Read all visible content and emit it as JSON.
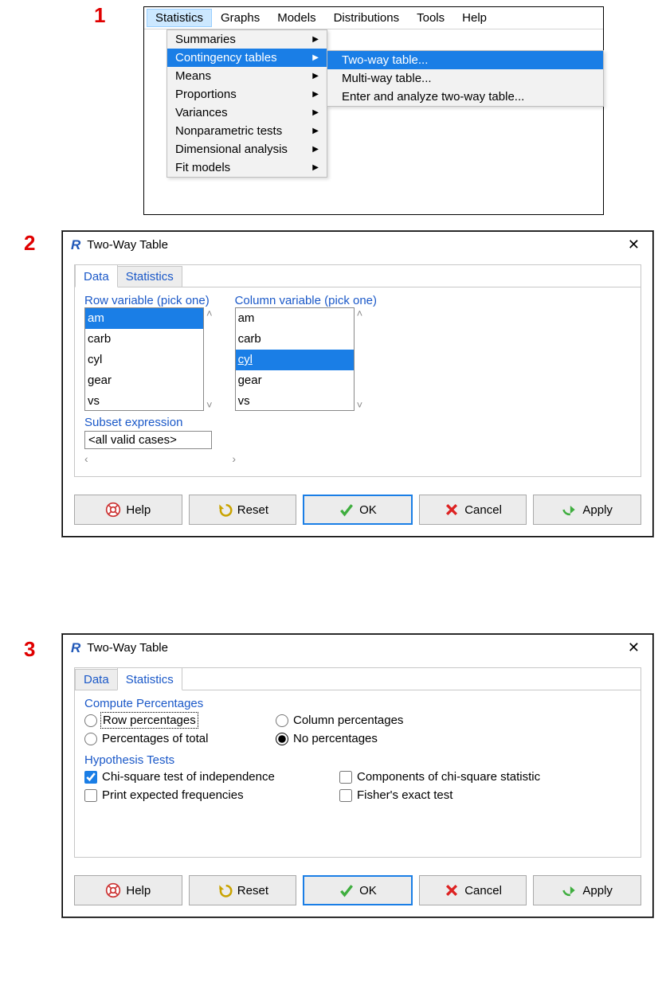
{
  "steps": {
    "s1": "1",
    "s2": "2",
    "s3": "3"
  },
  "menubar": {
    "items": [
      "Statistics",
      "Graphs",
      "Models",
      "Distributions",
      "Tools",
      "Help"
    ],
    "active": "Statistics"
  },
  "stats_menu": {
    "items": [
      {
        "label": "Summaries",
        "arrow": true
      },
      {
        "label": "Contingency tables",
        "arrow": true,
        "sel": true
      },
      {
        "label": "Means",
        "arrow": true
      },
      {
        "label": "Proportions",
        "arrow": true
      },
      {
        "label": "Variances",
        "arrow": true
      },
      {
        "label": "Nonparametric tests",
        "arrow": true
      },
      {
        "label": "Dimensional analysis",
        "arrow": true
      },
      {
        "label": "Fit models",
        "arrow": true
      }
    ]
  },
  "submenu": {
    "items": [
      {
        "label": "Two-way table...",
        "sel": true
      },
      {
        "label": "Multi-way table..."
      },
      {
        "label": "Enter and analyze two-way table..."
      }
    ]
  },
  "dialog": {
    "title": "Two-Way Table",
    "tabs": {
      "data": "Data",
      "stats": "Statistics"
    },
    "row_label": "Row variable (pick one)",
    "col_label": "Column variable (pick one)",
    "vars": [
      "am",
      "carb",
      "cyl",
      "gear",
      "vs"
    ],
    "row_selected": "am",
    "col_selected": "cyl",
    "subset_label": "Subset expression",
    "subset_value": "<all valid cases>",
    "buttons": {
      "help": "Help",
      "reset": "Reset",
      "ok": "OK",
      "cancel": "Cancel",
      "apply": "Apply"
    }
  },
  "stats_tab": {
    "pct_header": "Compute Percentages",
    "pct_options": {
      "row": "Row percentages",
      "col": "Column percentages",
      "total": "Percentages of total",
      "none": "No percentages"
    },
    "pct_selected": "none",
    "hyp_header": "Hypothesis Tests",
    "tests": {
      "chisq": "Chi-square test of independence",
      "components": "Components of chi-square statistic",
      "expected": "Print expected frequencies",
      "fisher": "Fisher's exact test"
    },
    "tests_checked": [
      "chisq"
    ]
  }
}
